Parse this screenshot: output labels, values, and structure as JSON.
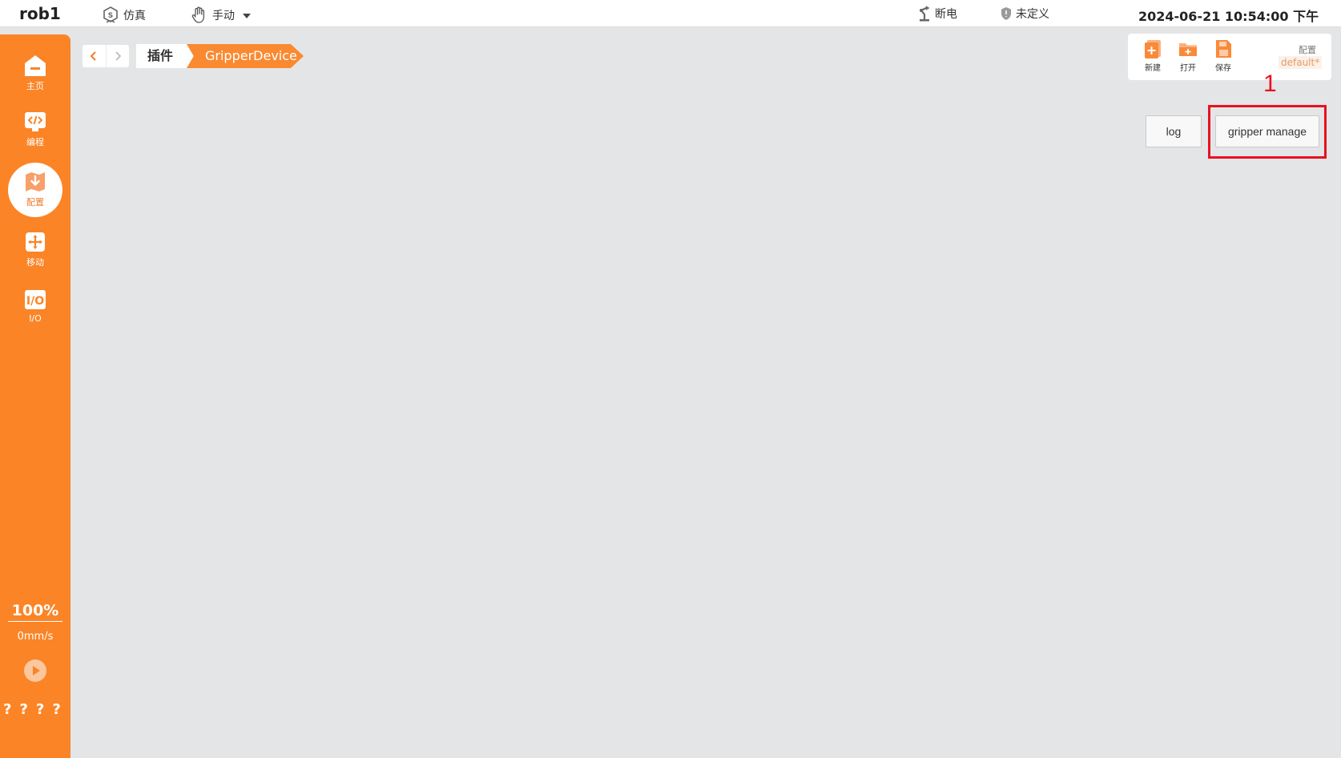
{
  "topbar": {
    "robot_name": "rob1",
    "mode_sim": "仿真",
    "mode_manual": "手动",
    "power": "断电",
    "safety": "未定义",
    "datetime": "2024-06-21 10:54:00 下午"
  },
  "sidebar": {
    "items": [
      {
        "label": "主页",
        "icon": "home-icon"
      },
      {
        "label": "编程",
        "icon": "code-icon"
      },
      {
        "label": "配置",
        "icon": "config-icon",
        "active": true
      },
      {
        "label": "移动",
        "icon": "move-icon"
      },
      {
        "label": "I/O",
        "icon": "io-icon"
      }
    ],
    "speed_percent": "100%",
    "speed_value": "0mm/s",
    "status_marks": "????"
  },
  "breadcrumb": {
    "items": [
      "插件",
      "GripperDevice"
    ]
  },
  "toolbar": {
    "new_label": "新建",
    "open_label": "打开",
    "save_label": "保存",
    "config_label": "配置",
    "config_value": "default*"
  },
  "actions": {
    "log_label": "log",
    "gripper_manage_label": "gripper manage",
    "annotation_number": "1"
  },
  "colors": {
    "accent": "#fb8426",
    "highlight": "#e8121f"
  }
}
